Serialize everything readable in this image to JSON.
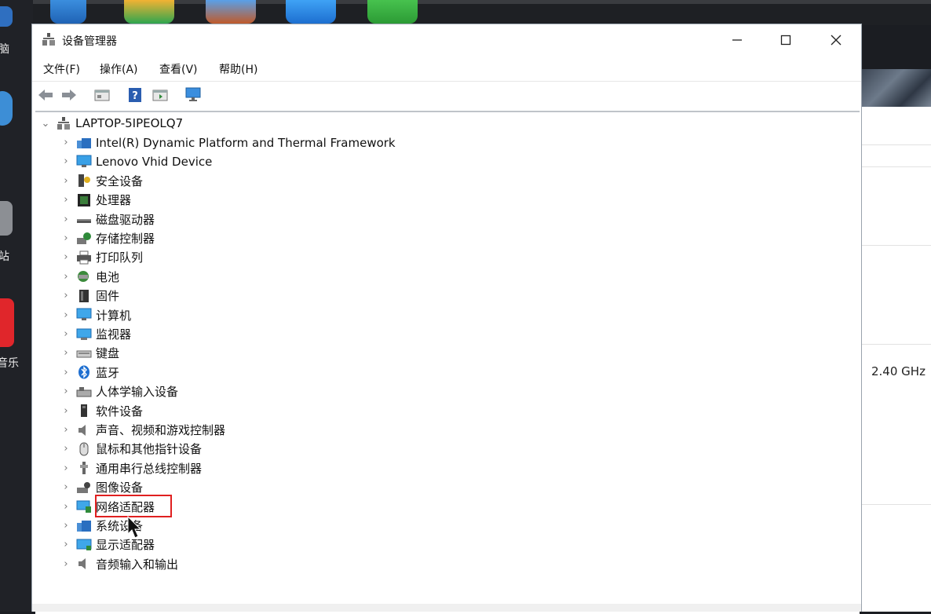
{
  "desktop": {
    "left_labels": [
      "脑",
      "站",
      "音乐"
    ],
    "right_panel_value": "2.40 GHz"
  },
  "window": {
    "title": "设备管理器",
    "menu": [
      "文件(F)",
      "操作(A)",
      "查看(V)",
      "帮助(H)"
    ],
    "tree": {
      "root": "LAPTOP-5IPEOLQ7",
      "items": [
        {
          "label": "Intel(R) Dynamic Platform and Thermal Framework",
          "icon": "thermal-framework-icon"
        },
        {
          "label": "Lenovo Vhid Device",
          "icon": "monitor-device-icon"
        },
        {
          "label": "安全设备",
          "icon": "security-device-icon"
        },
        {
          "label": "处理器",
          "icon": "processor-icon"
        },
        {
          "label": "磁盘驱动器",
          "icon": "disk-drive-icon"
        },
        {
          "label": "存储控制器",
          "icon": "storage-controller-icon"
        },
        {
          "label": "打印队列",
          "icon": "printer-icon"
        },
        {
          "label": "电池",
          "icon": "battery-icon"
        },
        {
          "label": "固件",
          "icon": "firmware-icon"
        },
        {
          "label": "计算机",
          "icon": "computer-icon"
        },
        {
          "label": "监视器",
          "icon": "monitor-icon"
        },
        {
          "label": "键盘",
          "icon": "keyboard-icon"
        },
        {
          "label": "蓝牙",
          "icon": "bluetooth-icon"
        },
        {
          "label": "人体学输入设备",
          "icon": "hid-icon"
        },
        {
          "label": "软件设备",
          "icon": "software-device-icon"
        },
        {
          "label": "声音、视频和游戏控制器",
          "icon": "speaker-icon"
        },
        {
          "label": "鼠标和其他指针设备",
          "icon": "mouse-icon"
        },
        {
          "label": "通用串行总线控制器",
          "icon": "usb-icon"
        },
        {
          "label": "图像设备",
          "icon": "camera-icon"
        },
        {
          "label": "网络适配器",
          "icon": "network-adapter-icon"
        },
        {
          "label": "系统设备",
          "icon": "system-device-icon"
        },
        {
          "label": "显示适配器",
          "icon": "display-adapter-icon"
        },
        {
          "label": "音频输入和输出",
          "icon": "audio-io-icon"
        }
      ]
    },
    "highlighted_item": "网络适配器"
  },
  "colors": {
    "highlight_border": "#e02020",
    "icon_blue": "#2a7fd4"
  }
}
